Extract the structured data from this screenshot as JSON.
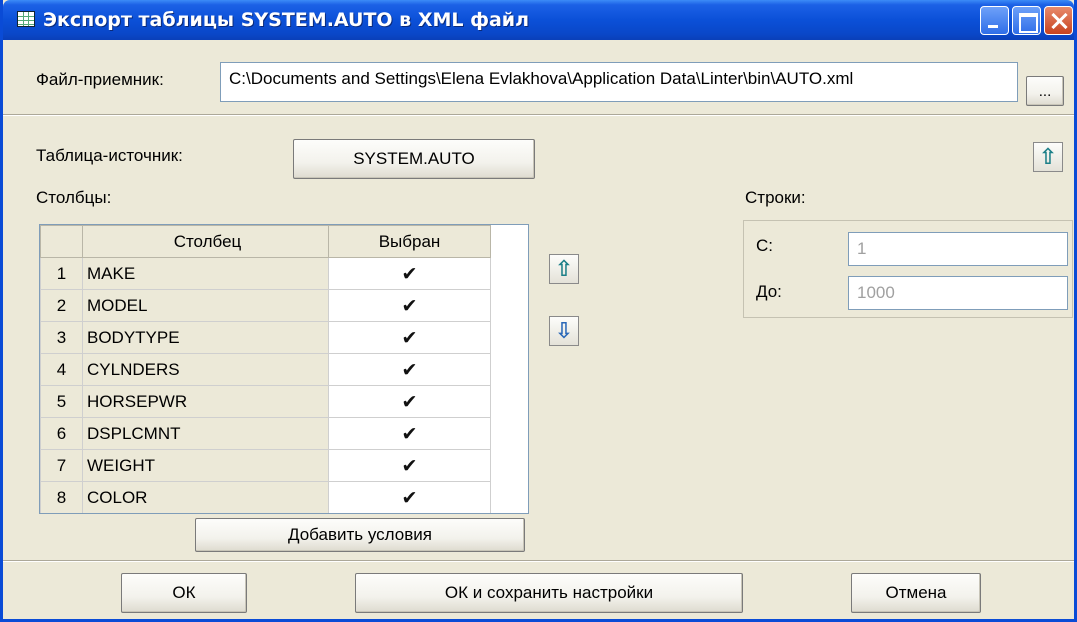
{
  "window": {
    "title": "Экспорт таблицы SYSTEM.AUTO в XML файл",
    "accent_color": "#0b50d8",
    "title_icon": "table-icon",
    "controls": [
      "minimize-icon",
      "maximize-icon",
      "close-icon"
    ]
  },
  "target": {
    "label": "Файл-приемник:",
    "path": "C:\\Documents and Settings\\Elena Evlakhova\\Application Data\\Linter\\bin\\AUTO.xml",
    "browse_label": "..."
  },
  "source": {
    "label": "Таблица-источник:",
    "table_button": "SYSTEM.AUTO"
  },
  "columns": {
    "label": "Столбцы:",
    "headers": [
      "",
      "Столбец",
      "Выбран"
    ],
    "rows": [
      {
        "num": "1",
        "name": "MAKE",
        "selected": "✔"
      },
      {
        "num": "2",
        "name": "MODEL",
        "selected": "✔"
      },
      {
        "num": "3",
        "name": "BODYTYPE",
        "selected": "✔"
      },
      {
        "num": "4",
        "name": "CYLNDERS",
        "selected": "✔"
      },
      {
        "num": "5",
        "name": "HORSEPWR",
        "selected": "✔"
      },
      {
        "num": "6",
        "name": "DSPLCMNT",
        "selected": "✔"
      },
      {
        "num": "7",
        "name": "WEIGHT",
        "selected": "✔"
      },
      {
        "num": "8",
        "name": "COLOR",
        "selected": "✔"
      }
    ],
    "move_up_icon": "arrow-up-icon",
    "move_down_icon": "arrow-down-icon",
    "add_conditions": "Добавить условия"
  },
  "rows_range": {
    "label": "Строки:",
    "from_label": "С:",
    "from_value": "1",
    "to_label": "До:",
    "to_value": "1000"
  },
  "footer": {
    "ok": "ОК",
    "ok_save": "ОК и сохранить настройки",
    "cancel": "Отмена"
  }
}
